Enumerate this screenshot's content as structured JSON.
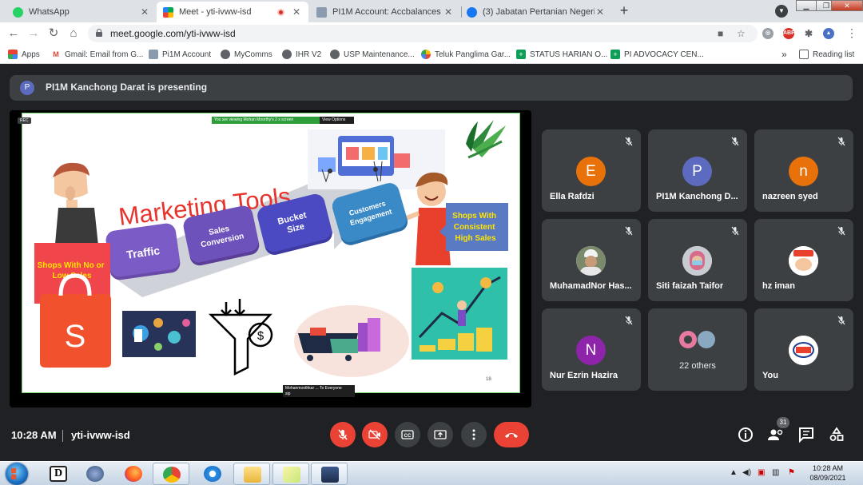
{
  "browser": {
    "tabs": [
      {
        "label": "WhatsApp",
        "active": false
      },
      {
        "label": "Meet - yti-ivww-isd",
        "active": true
      },
      {
        "label": "PI1M Account: Accbalances",
        "active": false
      },
      {
        "label": "(3) Jabatan Pertanian Negeri Sela",
        "active": false
      }
    ],
    "url": "meet.google.com/yti-ivww-isd",
    "bookmarks": [
      {
        "label": "Apps",
        "icon": "apps-grid-icon"
      },
      {
        "label": "Gmail: Email from G...",
        "icon": "gmail-icon"
      },
      {
        "label": "Pi1M Account",
        "icon": "site-icon"
      },
      {
        "label": "MyComms",
        "icon": "globe-icon"
      },
      {
        "label": "IHR V2",
        "icon": "globe-icon"
      },
      {
        "label": "USP Maintenance...",
        "icon": "globe-icon"
      },
      {
        "label": "Teluk Panglima Gar...",
        "icon": "pinwheel-icon"
      },
      {
        "label": "STATUS HARIAN O...",
        "icon": "sheets-icon"
      },
      {
        "label": "PI ADVOCACY CEN...",
        "icon": "sheets-icon"
      }
    ],
    "bookmarks_overflow": "»",
    "reading_list": "Reading list",
    "extensions": {
      "abp": "ABP"
    }
  },
  "meet": {
    "presenter_banner": "PI1M Kanchong Darat is presenting",
    "presenter_initial": "P",
    "slide": {
      "title": "Marketing Tools",
      "steps": [
        "Traffic",
        "Sales\nConversion",
        "Bucket\nSize",
        "Customers\nEngagement"
      ],
      "left_callout": "Shops With No or\nLow Sales",
      "right_callout": "Shops With\nConsistent\nHigh Sales",
      "page_number": "18",
      "viewing_bar": "You are viewing Mohan Moorthy's 2 s screen",
      "view_options": "View Options",
      "rec_chip": "REC",
      "caption": "Mohanmoothkar ... To Everyone",
      "caption_sub": "sip"
    },
    "participants": [
      {
        "name": "Ella Rafdzi",
        "initial": "E",
        "color": "#e8710a",
        "type": "initial"
      },
      {
        "name": "PI1M Kanchong D...",
        "initial": "P",
        "color": "#5c6bc0",
        "type": "initial"
      },
      {
        "name": "nazreen syed",
        "initial": "n",
        "color": "#e8710a",
        "type": "initial"
      },
      {
        "name": "MuhamadNor Has...",
        "type": "photo",
        "photo": "man-cap-photo"
      },
      {
        "name": "Siti faizah Taifor",
        "type": "photo",
        "photo": "woman-mask-photo"
      },
      {
        "name": "hz iman",
        "type": "photo",
        "photo": "logo-photo"
      },
      {
        "name": "Nur Ezrin Hazira",
        "initial": "N",
        "color": "#8e24aa",
        "type": "initial"
      },
      {
        "name": "22 others",
        "type": "others"
      },
      {
        "name": "You",
        "type": "photo",
        "photo": "org-logo-photo"
      }
    ],
    "time": "10:28 AM",
    "meeting_code": "yti-ivww-isd",
    "people_count": "31"
  },
  "taskbar": {
    "clock_time": "10:28 AM",
    "clock_date": "08/09/2021"
  },
  "colors": {
    "accent_red": "#ea4335",
    "tile_bg": "#3c4043",
    "stage_bg": "#202124"
  }
}
